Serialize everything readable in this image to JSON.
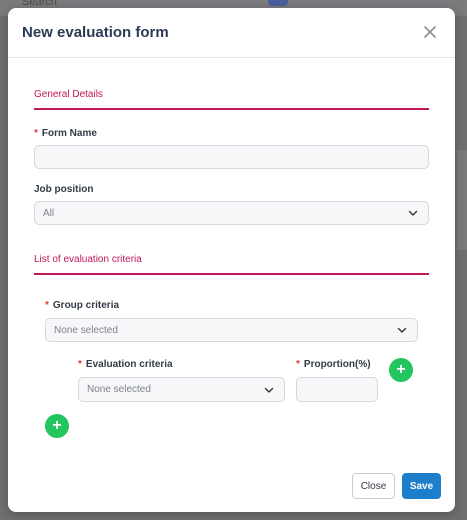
{
  "background": {
    "search_label": "Search"
  },
  "modal": {
    "title": "New evaluation form"
  },
  "general": {
    "section_title": "General Details",
    "form_name_label": "Form Name",
    "form_name_value": "",
    "job_position_label": "Job position",
    "job_position_value": "All"
  },
  "criteria": {
    "section_title": "List of evaluation criteria",
    "group_label": "Group criteria",
    "group_value": "None selected",
    "evaluation_label": "Evaluation criteria",
    "evaluation_value": "None selected",
    "proportion_label": "Proportion(%)",
    "proportion_value": ""
  },
  "footer": {
    "close_label": "Close",
    "save_label": "Save"
  },
  "colors": {
    "accent": "#c2185b",
    "primary": "#1d7fcc",
    "add": "#22c55e",
    "required": "#e53935"
  }
}
